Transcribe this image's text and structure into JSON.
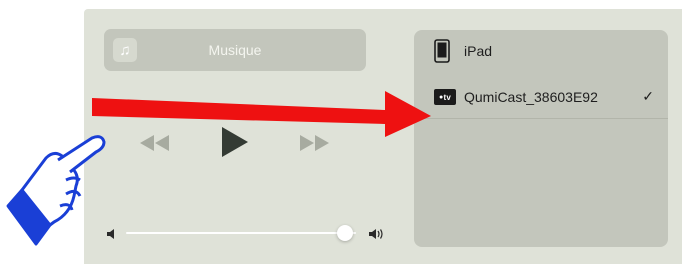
{
  "now_playing": {
    "title": "Musique",
    "icon": "music-note-icon"
  },
  "playback": {
    "rewind_icon": "rewind-icon",
    "play_icon": "play-icon",
    "forward_icon": "fast-forward-icon"
  },
  "volume": {
    "level": 0.95,
    "low_icon": "volume-low-icon",
    "high_icon": "volume-high-icon"
  },
  "airplay_devices": [
    {
      "label": "iPad",
      "icon": "ipad-icon",
      "selected": false
    },
    {
      "label": "QumiCast_38603E92",
      "icon": "apple-tv-icon",
      "badge": "tv",
      "selected": true,
      "check": "✓"
    }
  ],
  "annotations": {
    "arrow_color": "#ee1111",
    "hand_color": "#1a3fd6"
  }
}
